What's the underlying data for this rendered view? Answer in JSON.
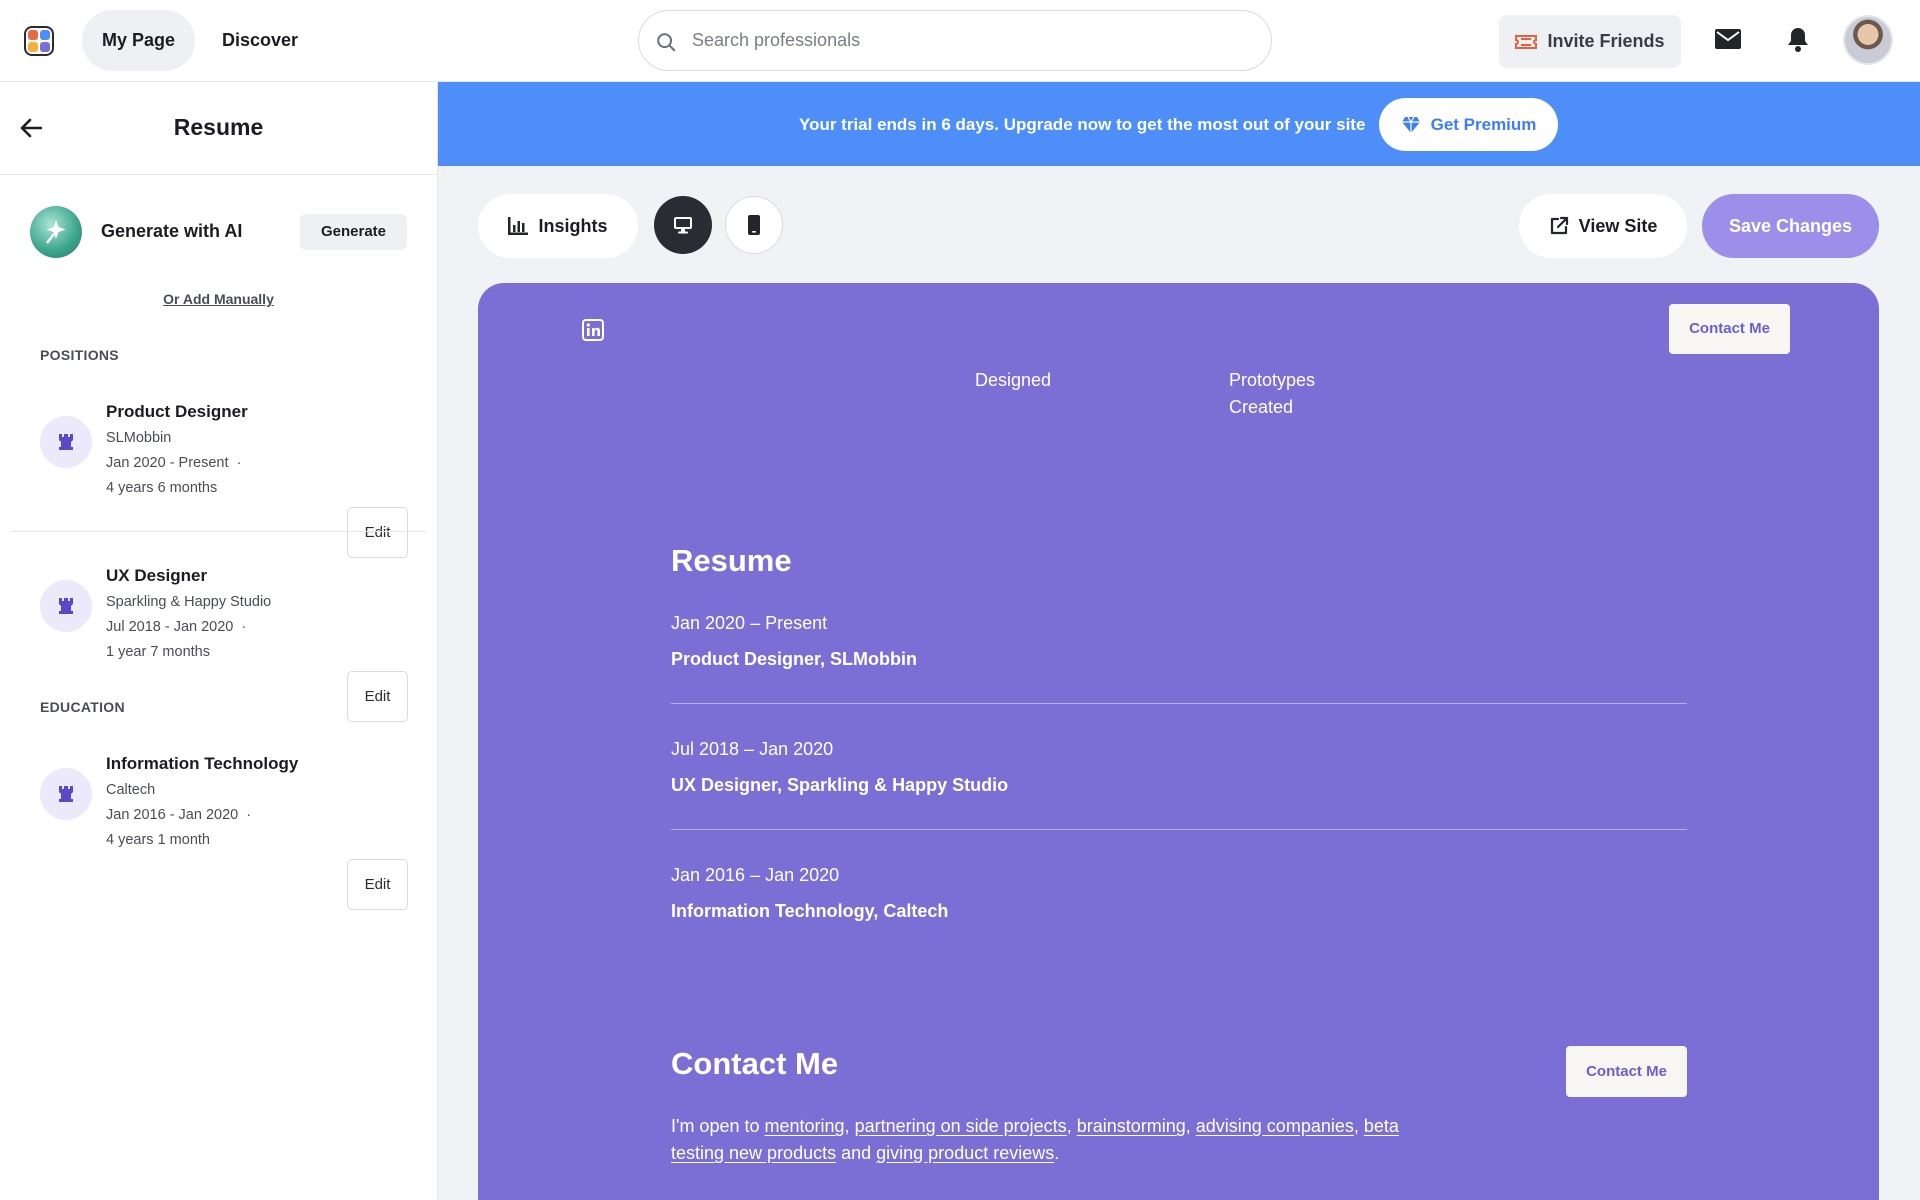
{
  "topbar": {
    "nav": {
      "my_page": "My Page",
      "discover": "Discover"
    },
    "search": {
      "placeholder": "Search professionals"
    },
    "invite_label": "Invite Friends",
    "logo_colors": [
      "#e86a4a",
      "#4d8ef8",
      "#f2b13a",
      "#7b6fd6"
    ]
  },
  "sidebar": {
    "title": "Resume",
    "generate_label": "Generate with AI",
    "generate_button": "Generate",
    "add_manually": "Or Add Manually",
    "positions_label": "POSITIONS",
    "education_label": "EDUCATION",
    "edit_label": "Edit",
    "positions": [
      {
        "title": "Product Designer",
        "company": "SLMobbin",
        "dates": "Jan 2020 - Present",
        "duration": "4 years 6 months"
      },
      {
        "title": "UX Designer",
        "company": "Sparkling & Happy Studio",
        "dates": "Jul 2018 - Jan 2020",
        "duration": "1 year 7 months"
      }
    ],
    "education": [
      {
        "title": "Information Technology",
        "company": "Caltech",
        "dates": "Jan 2016 - Jan 2020",
        "duration": "4 years 1 month"
      }
    ]
  },
  "banner": {
    "text": "Your trial ends in 6 days. Upgrade now to get the most out of your site",
    "button": "Get Premium",
    "color": "#4d8ef8"
  },
  "toolbar": {
    "insights": "Insights",
    "view_site": "View Site",
    "save": "Save Changes",
    "selected_device": "desktop"
  },
  "preview": {
    "accent": "#7b6fd6",
    "contact_button": "Contact Me",
    "stats": {
      "designed": "Designed",
      "prototypes_1": "Prototypes",
      "prototypes_2": "Created"
    },
    "resume_heading": "Resume",
    "resume": [
      {
        "dates": "Jan 2020 – Present",
        "role": "Product Designer, SLMobbin"
      },
      {
        "dates": "Jul 2018 – Jan 2020",
        "role": "UX Designer, Sparkling & Happy Studio"
      },
      {
        "dates": "Jan 2016 – Jan 2020",
        "role": "Information Technology, Caltech"
      }
    ],
    "contact_heading": "Contact Me",
    "intro": {
      "prefix": "I'm open to ",
      "links": [
        "mentoring",
        "partnering on side projects",
        "brainstorming",
        "advising companies",
        "beta testing new products",
        "giving product reviews"
      ],
      "and": " and ",
      "suffix": "."
    }
  }
}
